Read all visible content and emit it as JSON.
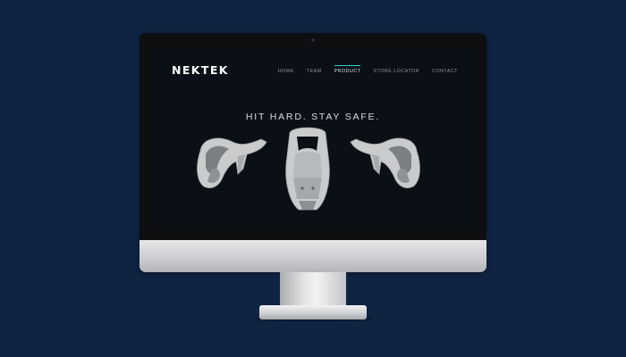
{
  "site": {
    "logo": "NEKTEK",
    "nav": [
      {
        "label": "HOME",
        "active": false
      },
      {
        "label": "TEAM",
        "active": false
      },
      {
        "label": "PRODUCT",
        "active": true
      },
      {
        "label": "STORE LOCATOR",
        "active": false
      },
      {
        "label": "CONTACT",
        "active": false
      }
    ],
    "headline": "HIT HARD. STAY SAFE."
  },
  "colors": {
    "page_background": "#0f2342",
    "screen_background": "#0b1016",
    "nav_accent": "#3fc7c9",
    "product_shell": "#c9cbcd"
  },
  "icons": {
    "products": [
      "neck-brace-left-view",
      "neck-brace-front-view",
      "neck-brace-right-view"
    ]
  }
}
